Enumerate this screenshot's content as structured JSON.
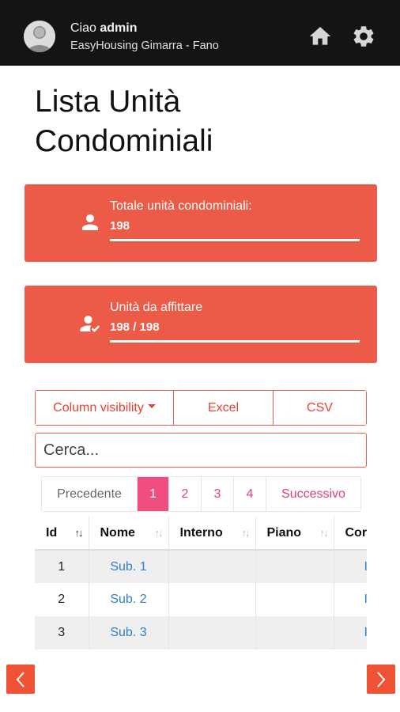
{
  "header": {
    "greeting_prefix": "Ciao",
    "username": "admin",
    "organization": "EasyHousing Gimarra - Fano",
    "icons": [
      "user-avatar",
      "home-icon",
      "gear-icon"
    ]
  },
  "page": {
    "title": "Lista Unità Condominiali"
  },
  "stats": [
    {
      "label": "Totale unità condominiali:",
      "value": "198",
      "icon": "person-icon"
    },
    {
      "label": "Unità da affittare",
      "value": "198 / 198",
      "icon": "person-check-icon"
    }
  ],
  "toolbar": {
    "column_visibility": "Column visibility",
    "excel": "Excel",
    "csv": "CSV"
  },
  "search": {
    "placeholder": "Cerca...",
    "value": ""
  },
  "pagination": {
    "prev": "Precedente",
    "pages": [
      "1",
      "2",
      "3",
      "4"
    ],
    "current": "1",
    "next": "Successivo"
  },
  "table": {
    "columns": [
      "Id",
      "Nome",
      "Interno",
      "Piano",
      "Cor"
    ],
    "rows": [
      {
        "id": "1",
        "nome": "Sub. 1",
        "interno": "",
        "piano": "",
        "cor": "I"
      },
      {
        "id": "2",
        "nome": "Sub. 2",
        "interno": "",
        "piano": "",
        "cor": "I"
      },
      {
        "id": "3",
        "nome": "Sub. 3",
        "interno": "",
        "piano": "",
        "cor": "I"
      }
    ]
  },
  "colors": {
    "topbar": "#141414",
    "card": "#ec5a48",
    "accent_pink": "#ef4f7e",
    "link_blue": "#2f7fc9",
    "nav_arrow": "#ef5234"
  }
}
